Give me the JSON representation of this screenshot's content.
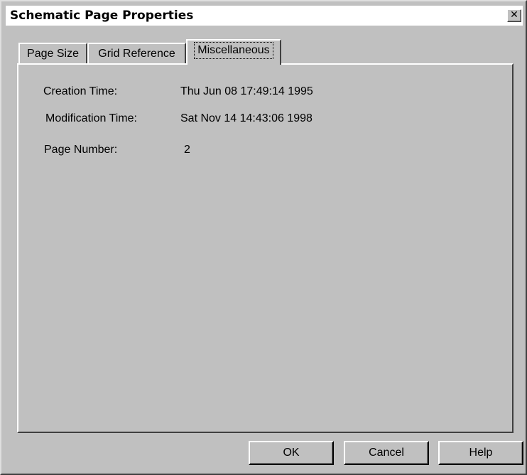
{
  "window": {
    "title": "Schematic Page Properties",
    "close_glyph": "✕"
  },
  "tabs": [
    {
      "label": "Page Size",
      "active": false
    },
    {
      "label": "Grid Reference",
      "active": false
    },
    {
      "label": "Miscellaneous",
      "active": true
    }
  ],
  "properties": {
    "creation_time": {
      "label": "Creation Time:",
      "value": "Thu Jun 08 17:49:14 1995"
    },
    "modification_time": {
      "label": "Modification Time:",
      "value": "Sat Nov 14 14:43:06 1998"
    },
    "page_number": {
      "label": "Page Number:",
      "value": "2"
    }
  },
  "buttons": {
    "ok": "OK",
    "cancel": "Cancel",
    "help": "Help"
  },
  "colors": {
    "face": "#c0c0c0",
    "highlight": "#ffffff",
    "shadow": "#404040"
  }
}
